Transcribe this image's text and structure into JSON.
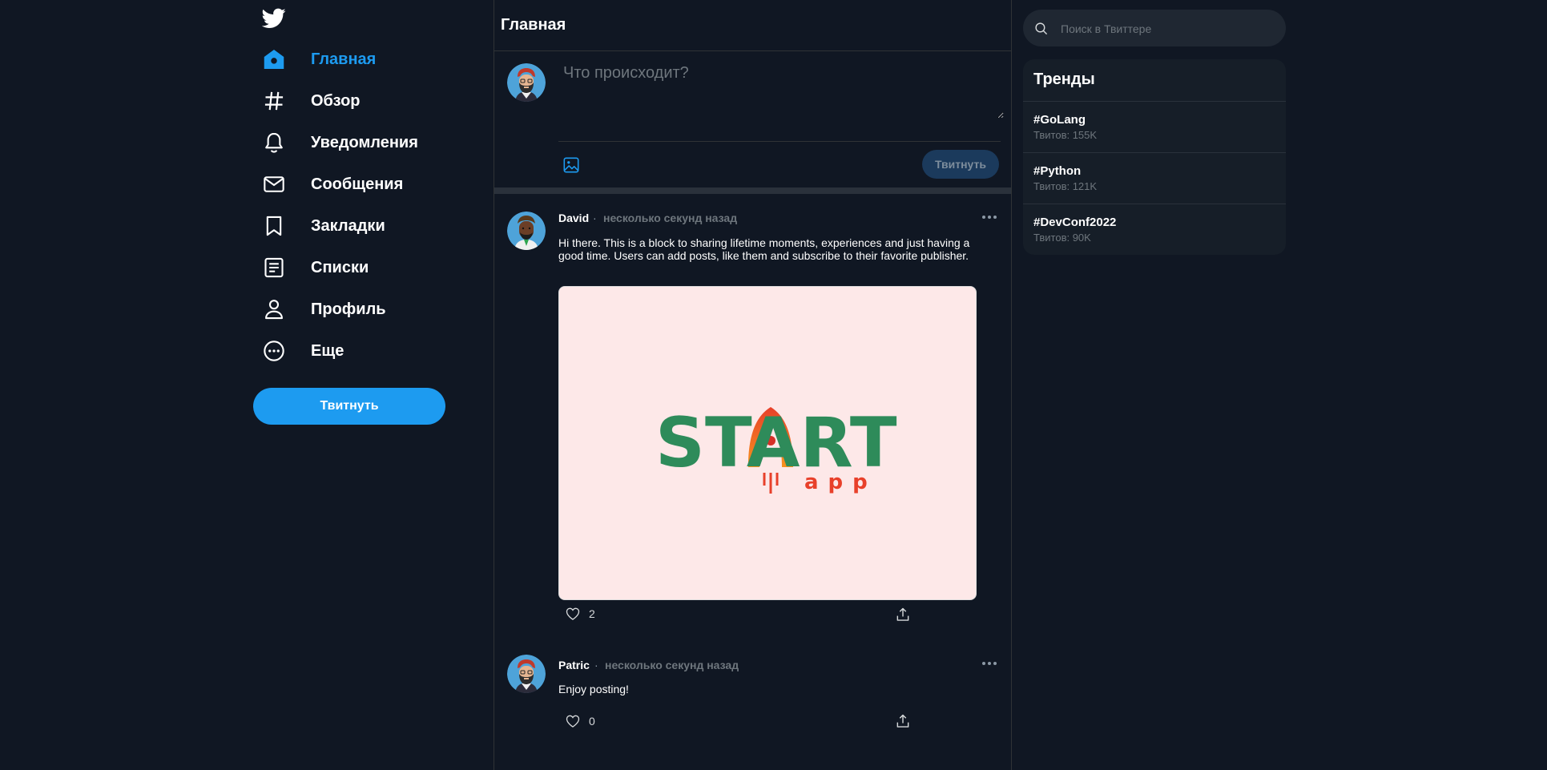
{
  "nav": {
    "items": [
      {
        "label": "Главная",
        "icon": "home-icon",
        "active": true
      },
      {
        "label": "Обзор",
        "icon": "hashtag-icon"
      },
      {
        "label": "Уведомления",
        "icon": "bell-icon"
      },
      {
        "label": "Сообщения",
        "icon": "envelope-icon"
      },
      {
        "label": "Закладки",
        "icon": "bookmark-icon"
      },
      {
        "label": "Списки",
        "icon": "list-icon"
      },
      {
        "label": "Профиль",
        "icon": "user-icon"
      },
      {
        "label": "Еще",
        "icon": "more-circle-icon"
      }
    ],
    "tweet_button": "Твитнуть",
    "logo": "twitter-bird-icon"
  },
  "main": {
    "title": "Главная",
    "composer": {
      "placeholder": "Что происходит?",
      "submit_label": "Твитнуть",
      "media_icon": "image-icon"
    },
    "posts": [
      {
        "author": "David",
        "separator": "·",
        "time": "несколько секунд назад",
        "text": "Hi there. This is a block to sharing lifetime moments, experiences and just having a good time. Users can add posts, like them and subscribe to their favorite publisher.",
        "image": {
          "word": "START",
          "sub": "app"
        },
        "likes": "2"
      },
      {
        "author": "Patric",
        "separator": "·",
        "time": "несколько секунд назад",
        "text": "Enjoy posting!",
        "likes": "0"
      }
    ]
  },
  "right": {
    "search_placeholder": "Поиск в Твиттере",
    "trends_title": "Тренды",
    "trends": [
      {
        "tag": "#GoLang",
        "count": "Твитов: 155K"
      },
      {
        "tag": "#Python",
        "count": "Твитов: 121K"
      },
      {
        "tag": "#DevConf2022",
        "count": "Твитов: 90K"
      }
    ]
  },
  "colors": {
    "background": "#101723",
    "accent": "#1d9bf0",
    "border": "#2f3336",
    "muted": "#6e767d",
    "image_bg": "#fde8e8",
    "start_green": "#2e8b5a",
    "start_red": "#e8402a"
  }
}
